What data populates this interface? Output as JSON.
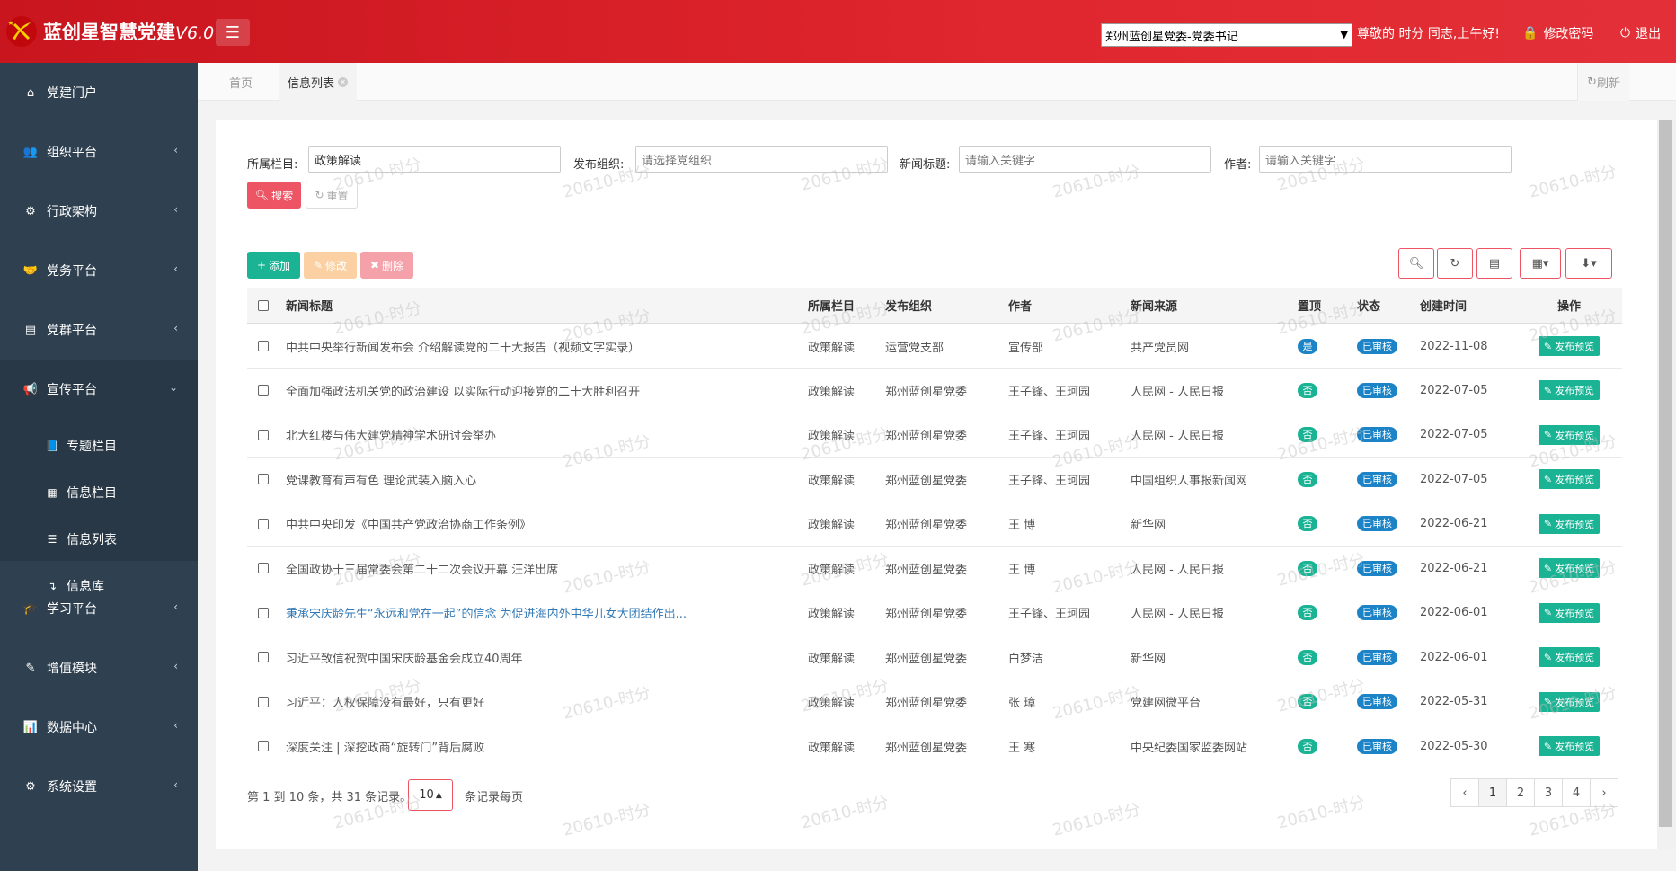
{
  "header": {
    "logo_text": "蓝创星智慧党建",
    "logo_version": "V6.0",
    "org_selected": "郑州蓝创星党委-党委书记",
    "greeting": "尊敬的 时分 同志,上午好!",
    "change_password": "修改密码",
    "logout": "退出"
  },
  "sidebar": {
    "items": [
      {
        "label": "党建门户",
        "icon": "home-icon"
      },
      {
        "label": "组织平台",
        "icon": "users-icon"
      },
      {
        "label": "行政架构",
        "icon": "cogs-icon"
      },
      {
        "label": "党务平台",
        "icon": "handshake-icon"
      },
      {
        "label": "党群平台",
        "icon": "id-card-icon"
      },
      {
        "label": "宣传平台",
        "icon": "bullhorn-icon"
      },
      {
        "label": "学习平台",
        "icon": "graduation-cap-icon"
      },
      {
        "label": "增值模块",
        "icon": "edit-icon"
      },
      {
        "label": "数据中心",
        "icon": "bar-chart-icon"
      },
      {
        "label": "系统设置",
        "icon": "gear-icon"
      }
    ],
    "sub_items": [
      {
        "label": "专题栏目",
        "icon": "book-icon"
      },
      {
        "label": "信息栏目",
        "icon": "newspaper-icon"
      },
      {
        "label": "信息列表",
        "icon": "list-icon"
      },
      {
        "label": "信息库",
        "icon": "level-down-icon"
      }
    ]
  },
  "tabs": {
    "home": "首页",
    "current": "信息列表",
    "refresh": "刷新"
  },
  "filters": {
    "column_label": "所属栏目:",
    "column_value": "政策解读",
    "org_label": "发布组织:",
    "org_placeholder": "请选择党组织",
    "title_label": "新闻标题:",
    "title_placeholder": "请输入关键字",
    "author_label": "作者:",
    "author_placeholder": "请输入关键字",
    "search": "搜索",
    "reset": "重置"
  },
  "toolbar": {
    "add": "添加",
    "edit": "修改",
    "delete": "删除"
  },
  "table": {
    "headers": [
      "新闻标题",
      "所属栏目",
      "发布组织",
      "作者",
      "新闻来源",
      "置顶",
      "状态",
      "创建时间",
      "操作"
    ],
    "rows": [
      {
        "title": "中共中央举行新闻发布会 介绍解读党的二十大报告（视频文字实录）",
        "column": "政策解读",
        "org": "运营党支部",
        "author": "宣传部",
        "source": "共产党员网",
        "top": "是",
        "status": "已审核",
        "date": "2022-11-08",
        "action": "发布预览"
      },
      {
        "title": "全面加强政法机关党的政治建设 以实际行动迎接党的二十大胜利召开",
        "column": "政策解读",
        "org": "郑州蓝创星党委",
        "author": "王子锋、王珂园",
        "source": "人民网 - 人民日报",
        "top": "否",
        "status": "已审核",
        "date": "2022-07-05",
        "action": "发布预览"
      },
      {
        "title": "北大红楼与伟大建党精神学术研讨会举办",
        "column": "政策解读",
        "org": "郑州蓝创星党委",
        "author": "王子锋、王珂园",
        "source": "人民网 - 人民日报",
        "top": "否",
        "status": "已审核",
        "date": "2022-07-05",
        "action": "发布预览"
      },
      {
        "title": "党课教育有声有色 理论武装入脑入心",
        "column": "政策解读",
        "org": "郑州蓝创星党委",
        "author": "王子锋、王珂园",
        "source": "中国组织人事报新闻网",
        "top": "否",
        "status": "已审核",
        "date": "2022-07-05",
        "action": "发布预览"
      },
      {
        "title": "中共中央印发《中国共产党政治协商工作条例》",
        "column": "政策解读",
        "org": "郑州蓝创星党委",
        "author": "王 博",
        "source": "新华网",
        "top": "否",
        "status": "已审核",
        "date": "2022-06-21",
        "action": "发布预览"
      },
      {
        "title": "全国政协十三届常委会第二十二次会议开幕 汪洋出席",
        "column": "政策解读",
        "org": "郑州蓝创星党委",
        "author": "王 博",
        "source": "人民网 - 人民日报",
        "top": "否",
        "status": "已审核",
        "date": "2022-06-21",
        "action": "发布预览"
      },
      {
        "title": "秉承宋庆龄先生“永远和党在一起”的信念 为促进海内外中华儿女大团结作出...",
        "column": "政策解读",
        "org": "郑州蓝创星党委",
        "author": "王子锋、王珂园",
        "source": "人民网 - 人民日报",
        "top": "否",
        "status": "已审核",
        "date": "2022-06-01",
        "action": "发布预览",
        "link": true
      },
      {
        "title": "习近平致信祝贺中国宋庆龄基金会成立40周年",
        "column": "政策解读",
        "org": "郑州蓝创星党委",
        "author": "白梦洁",
        "source": "新华网",
        "top": "否",
        "status": "已审核",
        "date": "2022-06-01",
        "action": "发布预览"
      },
      {
        "title": "习近平：人权保障没有最好，只有更好",
        "column": "政策解读",
        "org": "郑州蓝创星党委",
        "author": "张 璋",
        "source": "党建网微平台",
        "top": "否",
        "status": "已审核",
        "date": "2022-05-31",
        "action": "发布预览"
      },
      {
        "title": "深度关注 | 深挖政商“旋转门”背后腐败",
        "column": "政策解读",
        "org": "郑州蓝创星党委",
        "author": "王 寒",
        "source": "中央纪委国家监委网站",
        "top": "否",
        "status": "已审核",
        "date": "2022-05-30",
        "action": "发布预览"
      }
    ]
  },
  "pager": {
    "info": "第 1 到 10 条，共 31 条记录。",
    "page_size": "10",
    "page_size_label": "条记录每页",
    "pages": [
      "1",
      "2",
      "3",
      "4"
    ],
    "prev": "‹",
    "next": "›"
  },
  "watermark": "20610-时分",
  "colors": {
    "header_red": "#d81e26",
    "sidebar_bg": "#2f4050",
    "primary": "#1ab394",
    "danger": "#ed5565",
    "warning": "#f8ac59",
    "info_blue": "#1c84c6",
    "badge_top_yes": "#1c84c6",
    "badge_top_no": "#1ab394"
  }
}
